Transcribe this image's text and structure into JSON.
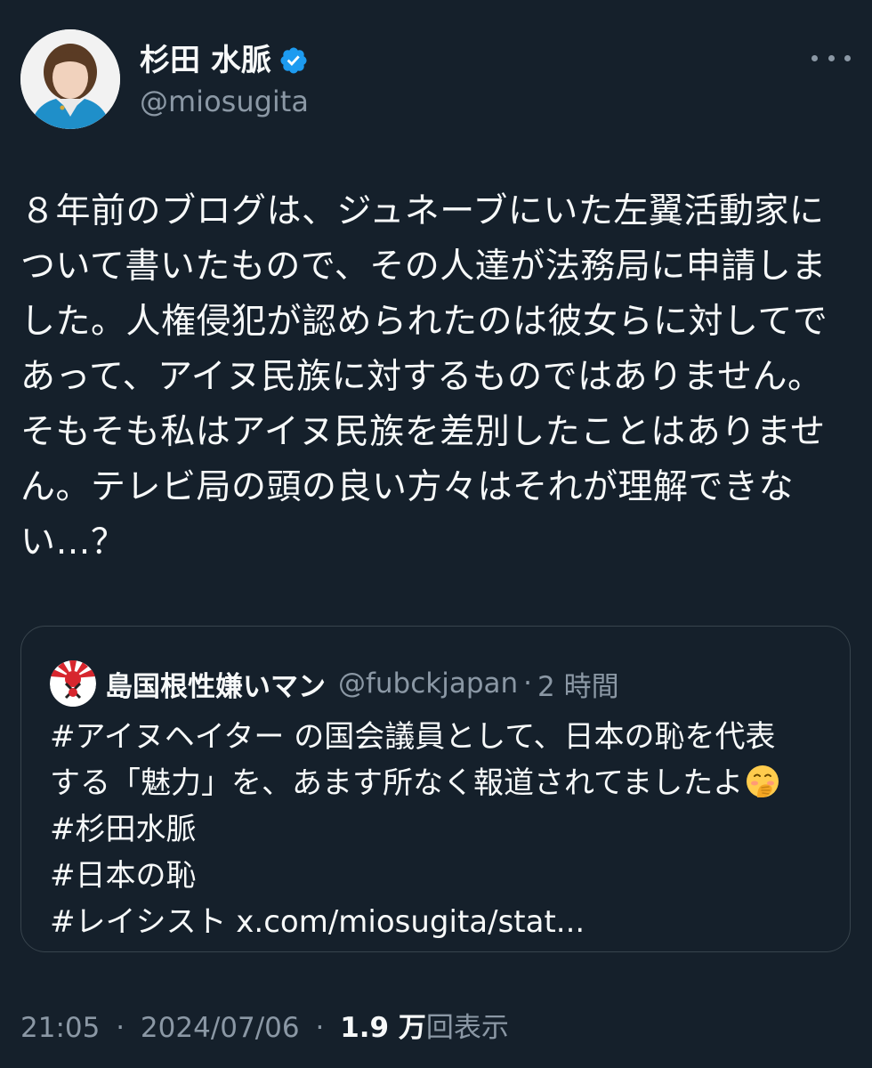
{
  "author": {
    "display_name": "杉田 水脈",
    "handle": "@miosugita",
    "verified": true,
    "avatar_icon": "profile-photo",
    "more_icon": "more-horizontal-icon"
  },
  "post": {
    "text": "８年前のブログは、ジュネーブにいた左翼活動家について書いたもので、その人達が法務局に申請しました。人権侵犯が認められたのは彼女らに対してであって、アイヌ民族に対するものではありません。そもそも私はアイヌ民族を差別したことはありません。テレビ局の頭の良い方々はそれが理解できない…？",
    "lines": [
      "８年前のブログは、ジュネーブにいた左翼活動家に",
      "ついて書いたもので、その人達が法務局に申請しま",
      "した。人権侵犯が認められたのは彼女らに対してで",
      "あって、アイヌ民族に対するものではありません。",
      "そもそも私はアイヌ民族を差別したことはありませ",
      "ん。テレビ局の頭の良い方々はそれが理解できな",
      "い…？"
    ]
  },
  "quote": {
    "display_name": "島国根性嫌いマン",
    "handle": "@fubckjapan",
    "separator": "·",
    "time": "2 時間",
    "lines": [
      "#アイヌヘイター の国会議員として、日本の恥を代表",
      "する「魅力」を、あます所なく報道されてましたよ",
      "#杉田水脈",
      "#日本の恥",
      "#レイシスト x.com/miosugita/stat..."
    ],
    "emoji": "face-with-hand-over-mouth",
    "avatar_icon": "rising-sun-logo"
  },
  "meta": {
    "time": "21:05",
    "separator": "·",
    "date": "2024/07/06",
    "views_count": "1.9 万",
    "views_label": "回表示"
  },
  "colors": {
    "background": "#15202b",
    "text": "#f7f9f9",
    "secondary": "#8b98a5",
    "border": "#38444d",
    "verified": "#1d9bf0"
  }
}
